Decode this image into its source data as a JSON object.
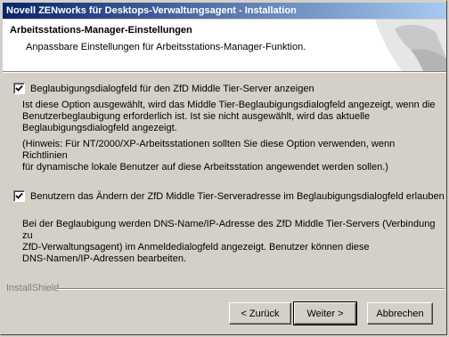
{
  "window": {
    "title": "Novell ZENworks für Desktops-Verwaltungsagent - Installation"
  },
  "header": {
    "title": "Arbeitsstations-Manager-Einstellungen",
    "subtitle": "Anpassbare Einstellungen für Arbeitsstations-Manager-Funktion."
  },
  "options": [
    {
      "checked": true,
      "label": "Beglaubigungsdialogfeld für den ZfD Middle Tier-Server anzeigen",
      "description_lines": [
        "Ist diese Option ausgewählt, wird das Middle Tier-Beglaubigungsdialogfeld angezeigt, wenn die",
        "Benutzerbeglaubigung erforderlich ist. Ist sie nicht ausgewählt, wird das aktuelle",
        "Beglaubigungsdialogfeld angezeigt."
      ],
      "note_lines": [
        "(Hinweis: Für NT/2000/XP-Arbeitsstationen sollten Sie diese Option verwenden, wenn Richtlinien",
        "für dynamische lokale Benutzer auf diese Arbeitsstation angewendet werden sollen.)"
      ]
    },
    {
      "checked": true,
      "label": "Benutzern das Ändern der ZfD Middle Tier-Serveradresse im Beglaubigungsdialogfeld erlauben",
      "description_lines": [
        "Bei der Beglaubigung werden DNS-Name/IP-Adresse des ZfD Middle Tier-Servers (Verbindung zu",
        "ZfD-Verwaltungsagent) im Anmeldedialogfeld angezeigt. Benutzer können diese",
        "DNS-Namen/IP-Adressen bearbeiten."
      ]
    }
  ],
  "footer": {
    "brand": "InstallShield",
    "back_label": "< Zurück",
    "next_label": "Weiter >",
    "cancel_label": "Abbrechen"
  }
}
